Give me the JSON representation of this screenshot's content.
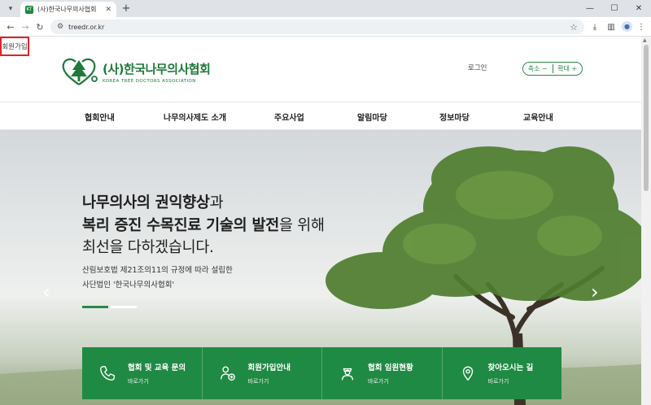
{
  "browser": {
    "tab_title": "(사)한국나무의사협회",
    "favicon_text": "KT",
    "url": "treedr.or.kr"
  },
  "header": {
    "logo_name": "(사)한국나무의사협회",
    "logo_sub": "KOREA TREE DOCTORS ASSOCIATION",
    "login": "로그인",
    "join": "회원가입",
    "zoom_out": "축소 −",
    "zoom_in": "확대 +"
  },
  "nav": {
    "items": [
      "협회안내",
      "나무의사제도 소개",
      "주요사업",
      "알림마당",
      "정보마당",
      "교육안내"
    ]
  },
  "hero": {
    "line1_bold": "나무의사의 권익향상",
    "line1_rest": "과",
    "line2_bold": "복리 증진 수목진료 기술의 발전",
    "line2_rest": "을 위해",
    "line3": "최선을 다하겠습니다.",
    "desc1": "산림보호법 제21조의11의 규정에 따라 설립한",
    "desc2": "사단법인 '한국나무의사협회'",
    "prev": "‹",
    "next": "›"
  },
  "quick": [
    {
      "title": "협회 및 교육 문의",
      "sub": "바로가기",
      "icon": "phone-icon"
    },
    {
      "title": "회원가입안내",
      "sub": "바로가기",
      "icon": "member-add-icon"
    },
    {
      "title": "협회 임원현황",
      "sub": "바로가기",
      "icon": "officer-icon"
    },
    {
      "title": "찾아오시는 길",
      "sub": "바로가기",
      "icon": "location-icon"
    }
  ],
  "colors": {
    "brand_green": "#1f8a43",
    "highlight_red": "#e4202a"
  }
}
